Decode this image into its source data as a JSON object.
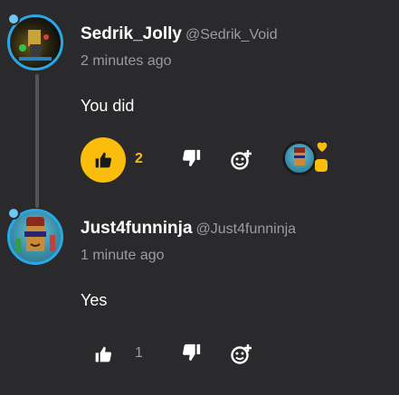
{
  "comments": [
    {
      "username": "Sedrik_Jolly",
      "handle": "@Sedrik_Void",
      "time": "2 minutes ago",
      "text": "You did",
      "likes": "2",
      "liked": true
    },
    {
      "username": "Just4funninja",
      "handle": "@Just4funninja",
      "time": "1 minute ago",
      "text": "Yes",
      "likes": "1",
      "liked": false
    }
  ],
  "colors": {
    "background": "#2a2a2c",
    "accent": "#fbbd0b",
    "avatar_ring": "#29a8e8",
    "muted_text": "#9c9ca0"
  },
  "icons": {
    "like": "thumbs-up-icon",
    "dislike": "thumbs-down-icon",
    "reply": "add-reaction-icon",
    "heart": "heart-icon"
  }
}
